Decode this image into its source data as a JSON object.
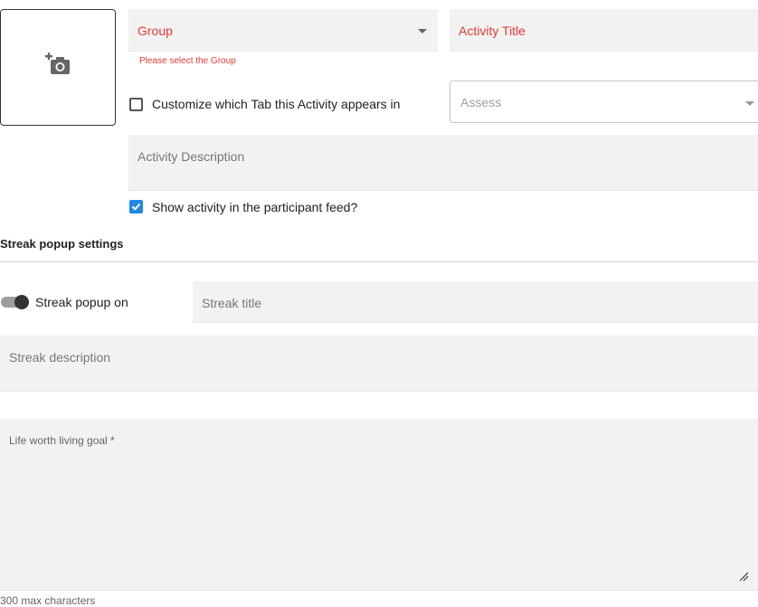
{
  "form": {
    "group": {
      "label": "Group",
      "error": "Please select the Group"
    },
    "activity_title": {
      "label": "Activity Title"
    },
    "customize_tab": {
      "label": "Customize which Tab this Activity appears in",
      "checked": false
    },
    "tab_select": {
      "placeholder": "Assess"
    },
    "activity_description": {
      "label": "Activity Description"
    },
    "show_in_feed": {
      "label": "Show activity in the participant feed?",
      "checked": true
    }
  },
  "streak": {
    "section_title": "Streak popup settings",
    "toggle_label": "Streak popup on",
    "toggle_on": true,
    "title_label": "Streak title",
    "description_label": "Streak description"
  },
  "goal": {
    "label": "Life worth living goal *",
    "helper": "300 max characters"
  },
  "icons": {
    "photo": "add-photo-camera-icon",
    "dropdown": "chevron-down-icon",
    "check": "check-icon",
    "resize": "resize-handle-icon"
  },
  "colors": {
    "error": "#e53935",
    "accent": "#1e88e5",
    "field_bg": "#f2f2f2"
  }
}
